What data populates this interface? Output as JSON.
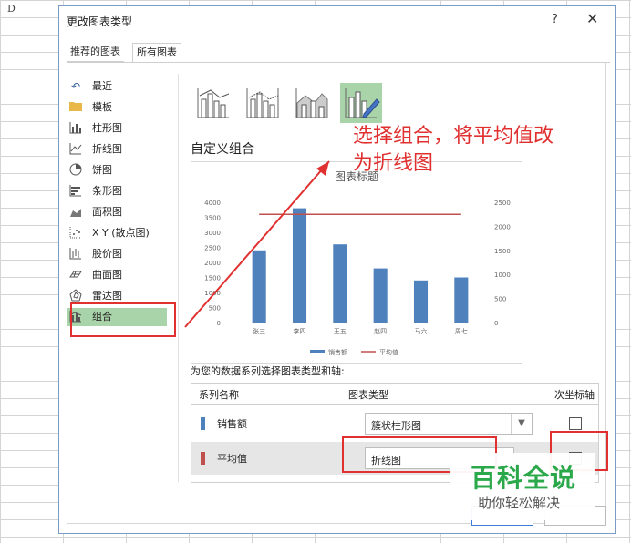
{
  "spreadsheet": {
    "column_letter": "D"
  },
  "dialog": {
    "title": "更改图表类型",
    "help_label": "?",
    "close_label": "✕",
    "tabs": [
      {
        "label": "推荐的图表",
        "active": false
      },
      {
        "label": "所有图表",
        "active": true
      }
    ],
    "chart_categories": [
      {
        "label": "最近",
        "icon": "undo-icon"
      },
      {
        "label": "模板",
        "icon": "folder-icon"
      },
      {
        "label": "柱形图",
        "icon": "column-chart-icon"
      },
      {
        "label": "折线图",
        "icon": "line-chart-icon"
      },
      {
        "label": "饼图",
        "icon": "pie-chart-icon"
      },
      {
        "label": "条形图",
        "icon": "bar-chart-icon"
      },
      {
        "label": "面积图",
        "icon": "area-chart-icon"
      },
      {
        "label": "X Y (散点图)",
        "icon": "scatter-chart-icon"
      },
      {
        "label": "股价图",
        "icon": "stock-chart-icon"
      },
      {
        "label": "曲面图",
        "icon": "surface-chart-icon"
      },
      {
        "label": "雷达图",
        "icon": "radar-chart-icon"
      },
      {
        "label": "组合",
        "icon": "combo-chart-icon",
        "selected": true
      }
    ],
    "section_title": "自定义组合",
    "annotation": "选择组合，将平均值改为折线图",
    "series_hint": "为您的数据系列选择图表类型和轴:",
    "series_table": {
      "headers": {
        "name": "系列名称",
        "type": "图表类型",
        "secondary": "次坐标轴"
      },
      "rows": [
        {
          "name": "销售额",
          "chart_type": "簇状柱形图",
          "color": "#4f81bd",
          "secondary_axis": false
        },
        {
          "name": "平均值",
          "chart_type": "折线图",
          "color": "#c0504d",
          "secondary_axis": false
        }
      ]
    }
  },
  "chart_data": {
    "type": "bar",
    "title": "图表标题",
    "categories": [
      "张三",
      "李四",
      "王五",
      "赵四",
      "马六",
      "周七"
    ],
    "series": [
      {
        "name": "销售额",
        "type": "bar",
        "values": [
          2400,
          3800,
          2600,
          1800,
          1400,
          1500
        ],
        "color": "#4f81bd"
      },
      {
        "name": "平均值",
        "type": "line",
        "values": [
          3600,
          3600,
          3600,
          3600,
          3600,
          3600
        ],
        "color": "#c0504d"
      }
    ],
    "ylim": [
      0,
      4000
    ],
    "yticks": [
      "0",
      "500",
      "1000",
      "1500",
      "2000",
      "2500",
      "3000",
      "3500",
      "4000"
    ],
    "y2ticks": [
      "0",
      "500",
      "1000",
      "1500",
      "2000",
      "2500"
    ],
    "grid": false,
    "legend": "bottom"
  },
  "watermark": {
    "main": "百科全说",
    "sub": "助你轻松解决"
  }
}
